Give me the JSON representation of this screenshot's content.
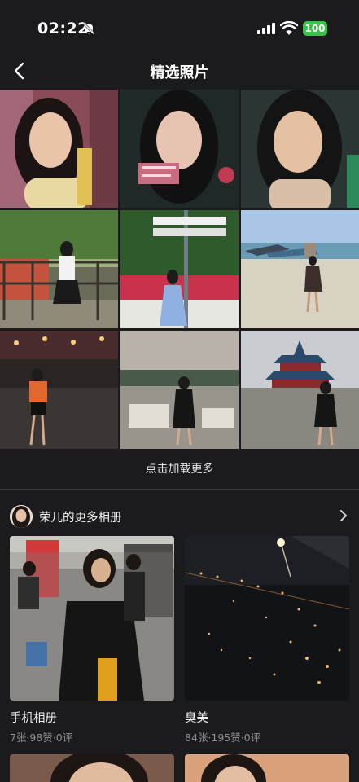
{
  "status_bar": {
    "time": "02:22",
    "battery": "100",
    "icons": [
      "bell-slash-icon",
      "cellular-signal-icon",
      "wifi-icon",
      "battery-icon"
    ]
  },
  "nav": {
    "back_icon": "chevron-left-icon",
    "title": "精选照片"
  },
  "photos": [
    {
      "label": "selfie-pink-curtain"
    },
    {
      "label": "selfie-watermarked"
    },
    {
      "label": "selfie-closeup"
    },
    {
      "label": "garden-railing"
    },
    {
      "label": "park-signpost"
    },
    {
      "label": "beach-longboats"
    },
    {
      "label": "city-night-street"
    },
    {
      "label": "palace-bridge"
    },
    {
      "label": "temple-of-heaven"
    }
  ],
  "load_more": "点击加载更多",
  "more_albums": {
    "title": "荣儿的更多相册",
    "albums": [
      {
        "name": "手机相册",
        "stats": "7张·98赞·0评"
      },
      {
        "name": "臭美",
        "stats": "84张·195赞·0评"
      }
    ]
  },
  "colors": {
    "background": "#1b1b1d",
    "battery": "#37c24a",
    "secondary_text": "#8e8e93"
  }
}
